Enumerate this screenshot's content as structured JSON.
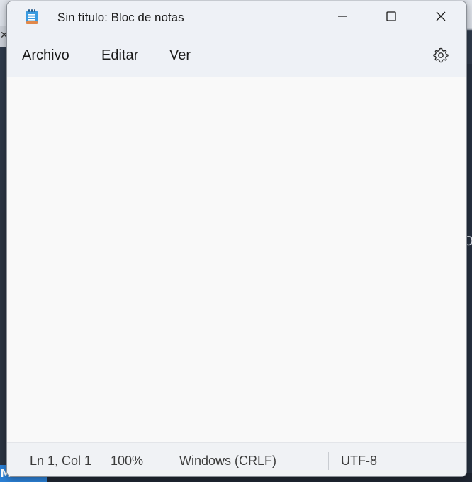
{
  "window": {
    "title": "Sin título: Bloc de notas",
    "icon": "notepad-icon"
  },
  "controls": {
    "minimize_icon": "minimize-icon",
    "maximize_icon": "maximize-icon",
    "close_icon": "close-icon"
  },
  "menu": {
    "items": [
      {
        "label": "Archivo"
      },
      {
        "label": "Editar"
      },
      {
        "label": "Ver"
      }
    ],
    "settings_icon": "gear-icon"
  },
  "editor": {
    "content": ""
  },
  "status": {
    "position": "Ln 1, Col 1",
    "zoom": "100%",
    "line_ending": "Windows (CRLF)",
    "encoding": "UTF-8"
  },
  "background": {
    "taskbar_fragment": "MA..."
  },
  "colors": {
    "titlebar": "#eef1f6",
    "editor_bg": "#f9f9f9",
    "statusbar": "#f0f2f5",
    "accent": "#2b7fd4"
  }
}
